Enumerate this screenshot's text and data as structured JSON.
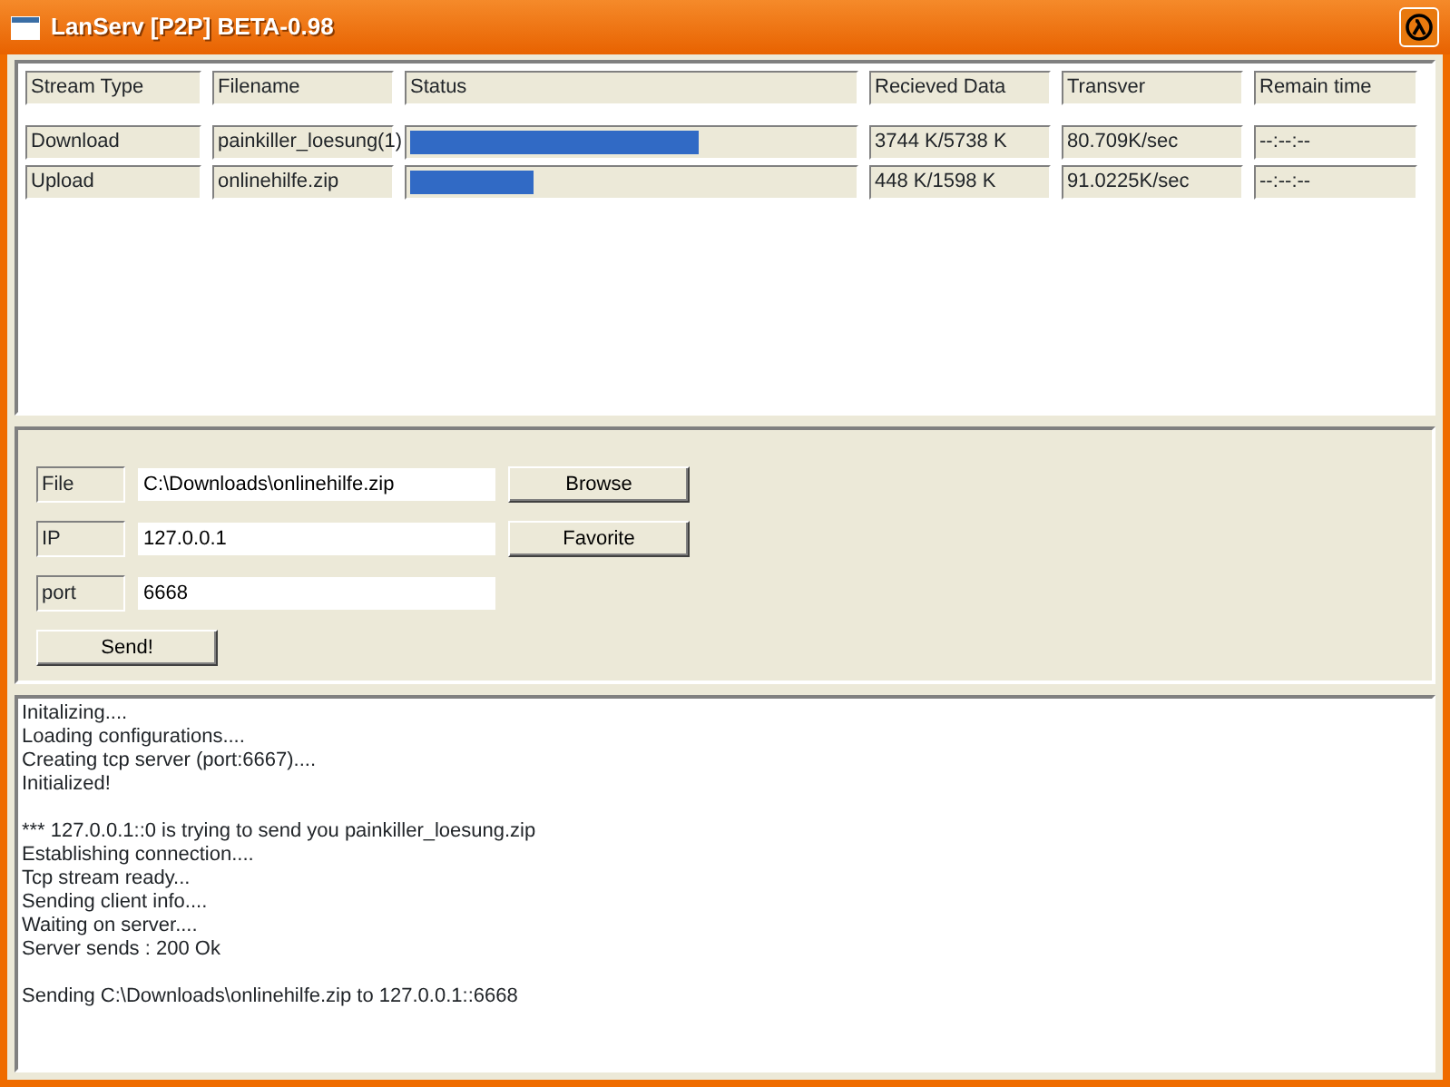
{
  "window": {
    "title": "LanServ [P2P] BETA-0.98"
  },
  "table": {
    "columns": [
      "Stream Type",
      "Filename",
      "Status",
      "Recieved Data",
      "Transver",
      "Remain time"
    ],
    "rows": [
      {
        "stream_type": "Download",
        "filename": "painkiller_loesung(1)",
        "level": 0.65,
        "received": "3744 K/5738 K",
        "transfer": "80.709K/sec",
        "remain": "--:--:--"
      },
      {
        "stream_type": "Upload",
        "filename": "onlinehilfe.zip",
        "level": 0.28,
        "received": "448 K/1598 K",
        "transfer": "91.0225K/sec",
        "remain": "--:--:--"
      }
    ]
  },
  "form": {
    "fields": [
      {
        "label": "File",
        "value": "C:\\Downloads\\onlinehilfe.zip",
        "button": "Browse"
      },
      {
        "label": "IP",
        "value": "127.0.0.1",
        "button": "Favorite"
      },
      {
        "label": "port",
        "value": "6668"
      }
    ],
    "send_button": "Send!"
  },
  "log": [
    [
      "Initalizing....",
      "Loading configurations....",
      "Creating tcp server (port:6667)....",
      "Initialized!"
    ],
    [
      "*** 127.0.0.1::0 is trying to send you painkiller_loesung.zip",
      "Establishing connection....",
      "Tcp stream ready...",
      "Sending client info....",
      "Waiting on server....",
      "Server sends : 200 Ok"
    ],
    [
      "Sending C:\\Downloads\\onlinehilfe.zip to 127.0.0.1::6668"
    ]
  ]
}
